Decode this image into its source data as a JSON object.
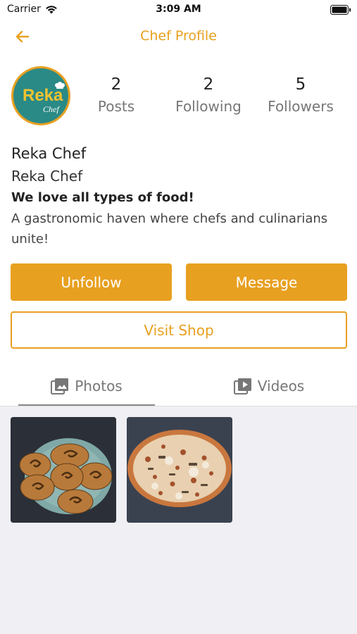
{
  "status_bar": {
    "carrier": "Carrier",
    "time": "3:09 AM"
  },
  "nav": {
    "title": "Chef Profile"
  },
  "avatar": {
    "logo_text": "Reka",
    "logo_sub": "Chef"
  },
  "stats": [
    {
      "value": "2",
      "label": "Posts"
    },
    {
      "value": "2",
      "label": "Following"
    },
    {
      "value": "5",
      "label": "Followers"
    }
  ],
  "bio": {
    "display_name": "Reka Chef",
    "username": "Reka Chef",
    "tagline": "We love all types of food!",
    "description": "A gastronomic haven where chefs and culinarians unite!"
  },
  "actions": {
    "unfollow": "Unfollow",
    "message": "Message",
    "visit_shop": "Visit Shop"
  },
  "tabs": [
    {
      "label": "Photos",
      "icon": "photos-icon",
      "active": true
    },
    {
      "label": "Videos",
      "icon": "videos-icon",
      "active": false
    }
  ],
  "photos": [
    {
      "subject": "rolled pastries on plate"
    },
    {
      "subject": "pizza"
    }
  ],
  "colors": {
    "accent": "#e8a020",
    "avatar_bg": "#2a8a86",
    "grid_bg": "#efeff4"
  }
}
